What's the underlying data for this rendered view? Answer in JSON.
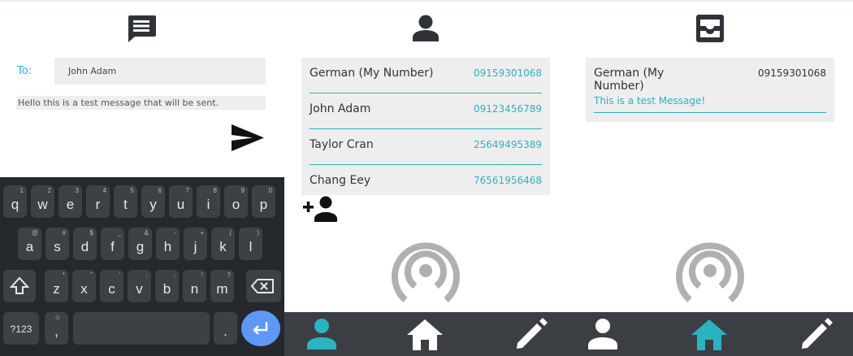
{
  "compose": {
    "header_icon": "message-icon",
    "to_label": "To:",
    "to_value": "John Adam",
    "message_value": "Hello this is a test message that will be sent.",
    "send_icon": "send-icon"
  },
  "keyboard": {
    "row1": [
      {
        "main": "q",
        "hint": "1"
      },
      {
        "main": "w",
        "hint": "2"
      },
      {
        "main": "e",
        "hint": "3"
      },
      {
        "main": "r",
        "hint": "4"
      },
      {
        "main": "t",
        "hint": "5"
      },
      {
        "main": "y",
        "hint": "6"
      },
      {
        "main": "u",
        "hint": "7"
      },
      {
        "main": "i",
        "hint": "8"
      },
      {
        "main": "o",
        "hint": "9"
      },
      {
        "main": "p",
        "hint": "0"
      }
    ],
    "row2": [
      {
        "main": "a",
        "hint": "@"
      },
      {
        "main": "s",
        "hint": "#"
      },
      {
        "main": "d",
        "hint": "$"
      },
      {
        "main": "f",
        "hint": "_"
      },
      {
        "main": "g",
        "hint": "&"
      },
      {
        "main": "h",
        "hint": "-"
      },
      {
        "main": "j",
        "hint": "+"
      },
      {
        "main": "k",
        "hint": "("
      },
      {
        "main": "l",
        "hint": ")"
      }
    ],
    "row3": [
      {
        "main": "z",
        "hint": "*"
      },
      {
        "main": "x",
        "hint": "\""
      },
      {
        "main": "c",
        "hint": "'"
      },
      {
        "main": "v",
        "hint": ":"
      },
      {
        "main": "b",
        "hint": ";"
      },
      {
        "main": "n",
        "hint": "!"
      },
      {
        "main": "m",
        "hint": "?"
      }
    ],
    "symbols_label": "?123",
    "emoji_hint": "☺",
    "comma": ",",
    "period": ".",
    "shift_icon": "shift-icon",
    "backspace_icon": "backspace-icon",
    "enter_icon": "enter-icon"
  },
  "contacts": {
    "header_icon": "person-icon",
    "rows": [
      {
        "name": "German (My Number)",
        "number": "09159301068"
      },
      {
        "name": "John Adam",
        "number": "09123456789"
      },
      {
        "name": "Taylor Cran",
        "number": "25649495389"
      },
      {
        "name": "Chang Eey",
        "number": "76561956468"
      }
    ],
    "add_icon": "add-person-icon",
    "signal_icon": "wireless-signal-icon"
  },
  "inbox": {
    "header_icon": "inbox-icon",
    "name": "German (My Number)",
    "number": "09159301068",
    "message": "This is a test Message!",
    "signal_icon": "wireless-signal-icon"
  },
  "navbar": {
    "items": [
      {
        "icon": "person-icon"
      },
      {
        "icon": "home-icon"
      },
      {
        "icon": "edit-pencil-icon"
      }
    ],
    "accent": "#2bb3c0",
    "inactive": "#ffffff",
    "background": "#3b3e43"
  },
  "colors": {
    "accent": "#2bb3c0",
    "field_bg": "#eeeeee",
    "keyboard_bg": "#25282c",
    "key_bg": "#3d4044",
    "enter_key": "#5e97f6",
    "icon_dark": "#2f3338",
    "signal_gray": "#b0b0b0"
  }
}
